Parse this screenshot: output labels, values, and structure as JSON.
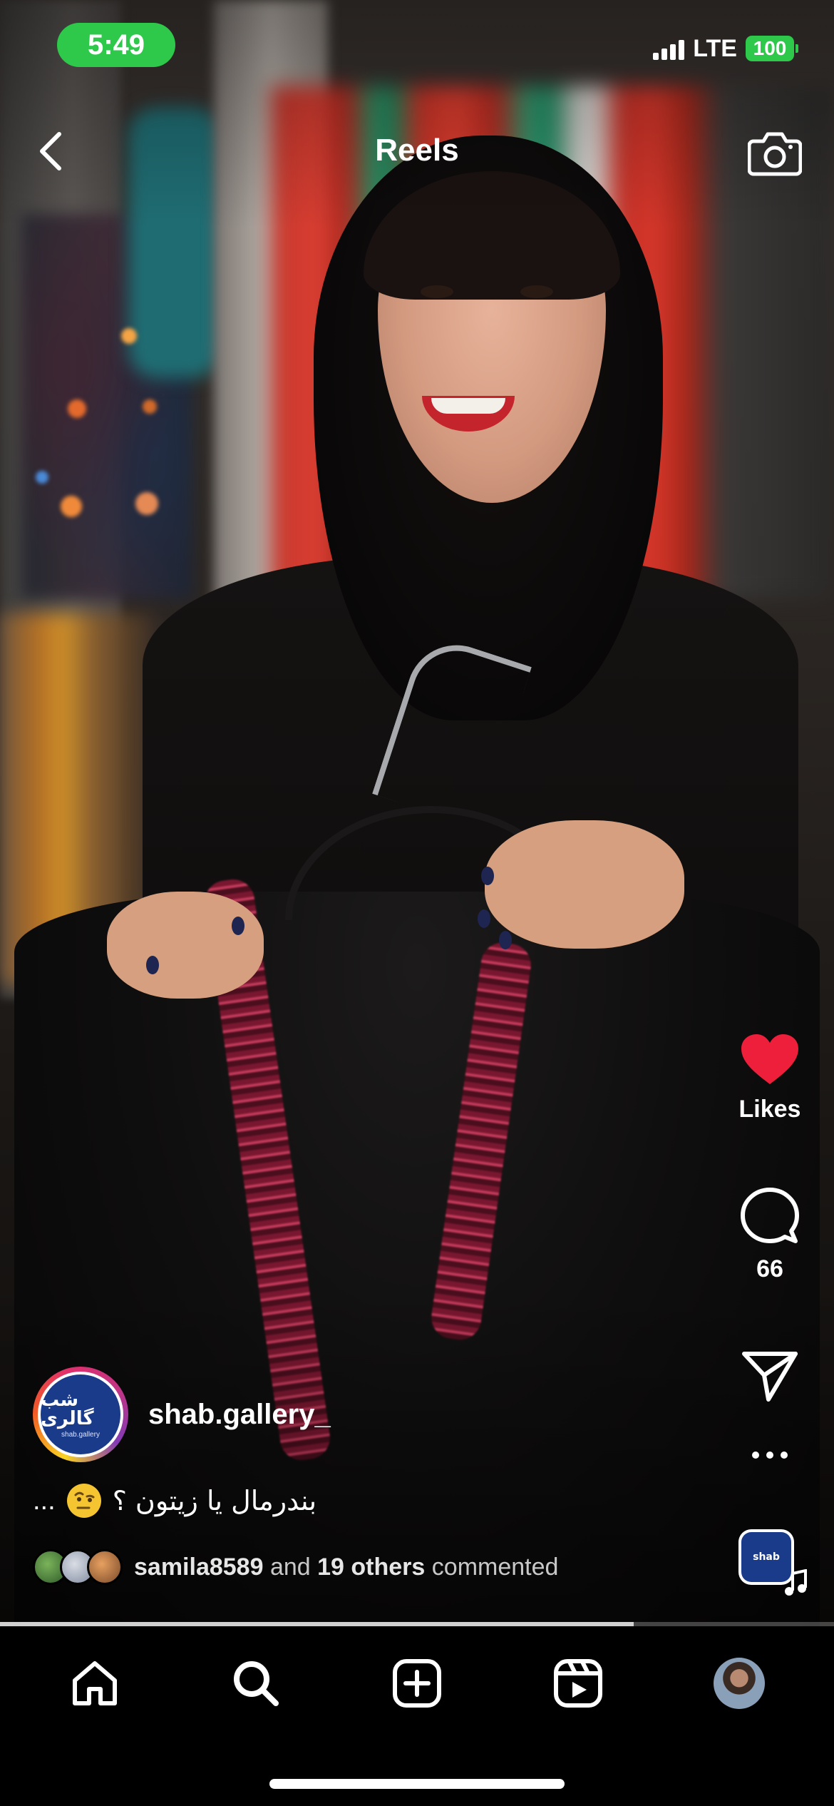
{
  "status_bar": {
    "time": "5:49",
    "network": "LTE",
    "battery": "100",
    "accent_color": "#2ec84b"
  },
  "header": {
    "title": "Reels",
    "back_icon": "chevron-left-icon",
    "camera_icon": "camera-icon"
  },
  "actions": {
    "like_label": "Likes",
    "like_color": "#ed1f3a",
    "comments_count": "66",
    "share_icon": "paper-plane-icon",
    "more_icon": "more-horizontal-icon",
    "audio_icon": "music-note-icon"
  },
  "post": {
    "username": "shab.gallery_",
    "caption": "بندرمال یا زیتون ؟",
    "caption_ellipsis": "...",
    "comment_user": "samila8589",
    "comment_and": "and",
    "comment_others": "19 others",
    "comment_suffix": "commented"
  },
  "progress": {
    "fraction": 0.76
  },
  "bottom_nav": {
    "items": [
      "home-icon",
      "search-icon",
      "create-post-icon",
      "reels-icon",
      "profile-avatar"
    ]
  }
}
